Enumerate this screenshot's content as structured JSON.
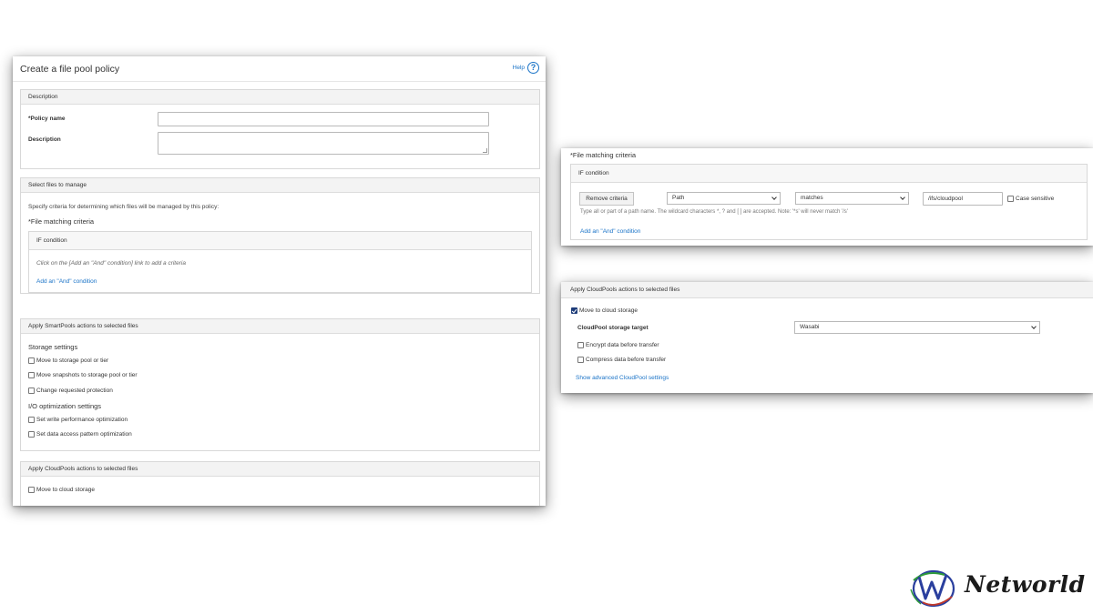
{
  "main": {
    "title": "Create a file pool policy",
    "help_label": "Help",
    "description_section": {
      "header": "Description",
      "policy_name_label": "*Policy name",
      "policy_name_value": "",
      "description_label": "Description",
      "description_value": ""
    },
    "select_files_section": {
      "header": "Select files to manage",
      "intro": "Specify criteria for determining which files will be managed by this policy:",
      "criteria_heading": "*File matching criteria",
      "if_condition_header": "IF condition",
      "empty_hint": "Click on the [Add an \"And\" condition] link to add a criteria",
      "add_and_link": "Add an \"And\" condition"
    },
    "smartpools_section": {
      "header": "Apply SmartPools actions to selected files",
      "storage_heading": "Storage settings",
      "storage_options": [
        {
          "label": "Move to storage pool or tier",
          "checked": false
        },
        {
          "label": "Move snapshots to storage pool or tier",
          "checked": false
        },
        {
          "label": "Change requested protection",
          "checked": false
        }
      ],
      "io_heading": "I/O optimization settings",
      "io_options": [
        {
          "label": "Set write performance optimization",
          "checked": false
        },
        {
          "label": "Set data access pattern optimization",
          "checked": false
        }
      ]
    },
    "cloudpools_section": {
      "header": "Apply CloudPools actions to selected files",
      "move_label": "Move to cloud storage",
      "move_checked": false
    }
  },
  "criteria_panel": {
    "heading": "*File matching criteria",
    "if_condition_header": "IF condition",
    "remove_button": "Remove criteria",
    "field_select": "Path",
    "operator_select": "matches",
    "path_value": "/ifs/cloudpool",
    "case_sensitive_label": "Case sensitive",
    "case_sensitive_checked": false,
    "hint": "Type all or part of a path name. The wildcard characters *, ? and [ ] are accepted. Note: '*s' will never match '/s'",
    "add_and_link": "Add an \"And\" condition"
  },
  "cloud_panel": {
    "header": "Apply CloudPools actions to selected files",
    "move_label": "Move to cloud storage",
    "move_checked": true,
    "target_label": "CloudPool storage target",
    "target_value": "Wasabi",
    "encrypt_label": "Encrypt data before transfer",
    "encrypt_checked": false,
    "compress_label": "Compress data before transfer",
    "compress_checked": false,
    "advanced_link": "Show advanced CloudPool settings"
  },
  "logo": {
    "text": "Networld",
    "colors": {
      "blue": "#2a3f9e",
      "green": "#2e9a3a",
      "red": "#c0392b"
    }
  }
}
